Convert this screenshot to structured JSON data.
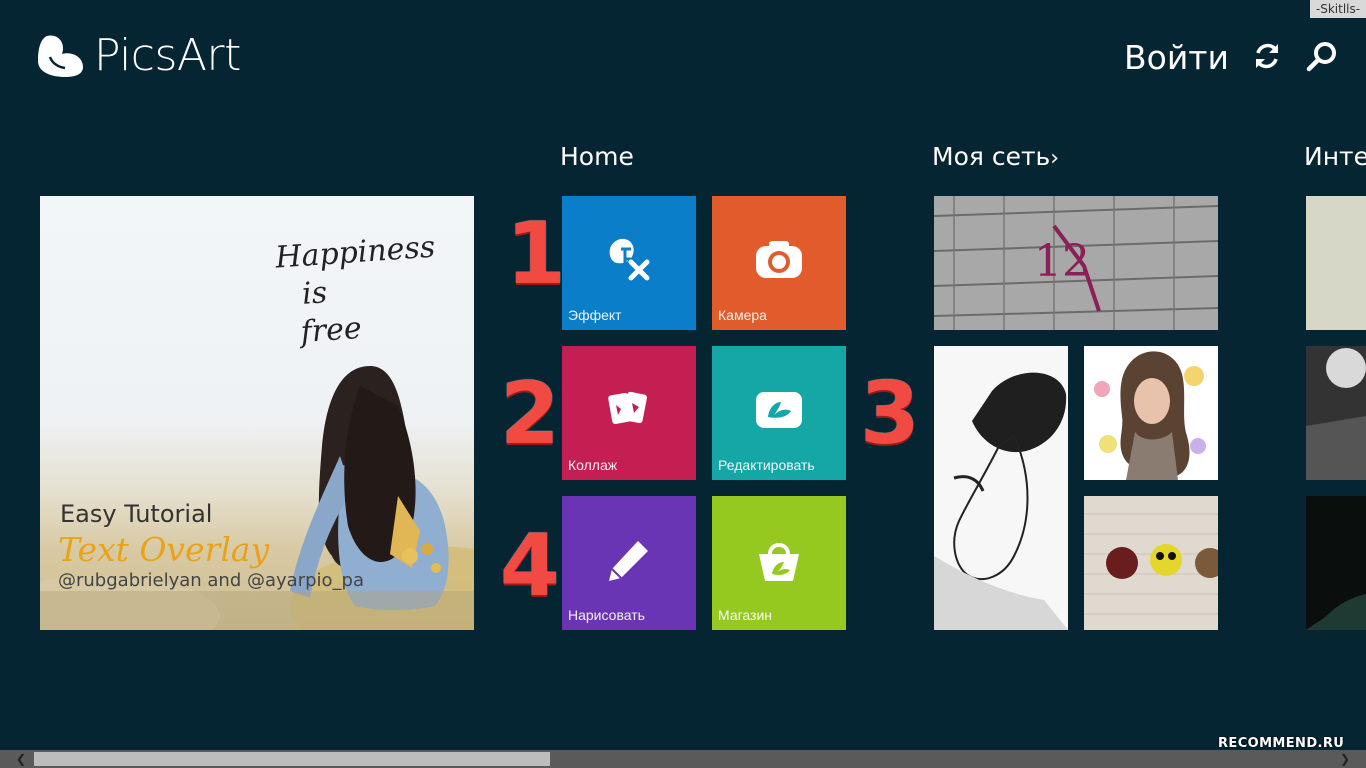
{
  "watermark_top": "-Skitlls-",
  "header": {
    "logo_text": "PicsArt",
    "login_label": "Войти"
  },
  "sections": {
    "home": "Home",
    "my_network": "Моя сеть",
    "next_section_partial": "Интер"
  },
  "hero": {
    "quote": [
      "Happiness",
      "is",
      "free"
    ],
    "title": "Easy Tutorial",
    "subtitle": "Text Overlay",
    "credit": "@rubgabrielyan and @ayarpio_pa"
  },
  "tiles": [
    {
      "label": "Эффект",
      "color": "#0a7ec8",
      "icon": "fx-icon"
    },
    {
      "label": "Камера",
      "color": "#e25b2c",
      "icon": "camera-icon"
    },
    {
      "label": "Коллаж",
      "color": "#c41e52",
      "icon": "collage-icon"
    },
    {
      "label": "Редактировать",
      "color": "#14a7a6",
      "icon": "edit-photo-icon"
    },
    {
      "label": "Нарисовать",
      "color": "#6a35b5",
      "icon": "pencil-icon"
    },
    {
      "label": "Магазин",
      "color": "#96c91f",
      "icon": "shop-bag-icon"
    }
  ],
  "annotations": [
    "1",
    "2",
    "3",
    "4"
  ],
  "watermark_bottom": "RECOMMEND.RU",
  "colors": {
    "background": "#062533",
    "annotation_red": "#f04a43",
    "scrollbar_track": "#5a5a5a",
    "scrollbar_thumb": "#bdbdbd"
  }
}
